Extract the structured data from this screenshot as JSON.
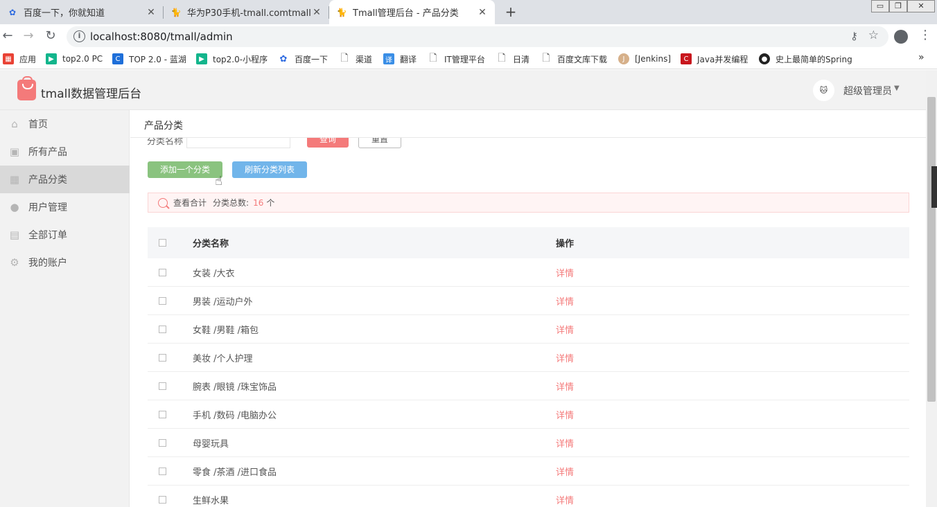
{
  "browser": {
    "tabs": [
      {
        "title": "百度一下，你就知道",
        "active": false
      },
      {
        "title": "华为P30手机-tmall.comtmall",
        "active": false
      },
      {
        "title": "Tmall管理后台 - 产品分类",
        "active": true
      }
    ],
    "new_tab": "+",
    "url": "localhost:8080/tmall/admin",
    "window_controls": [
      "▭",
      "❐",
      "✕"
    ],
    "bookmarks": [
      {
        "label": "应用",
        "icon": "apps-grid-icon",
        "color": "#e94235"
      },
      {
        "label": "top2.0 PC",
        "icon": "play-icon",
        "color": "#13b58c"
      },
      {
        "label": "TOP 2.0 - 蓝湖",
        "icon": "lanhu-icon",
        "color": "#1e6fd9"
      },
      {
        "label": "top2.0-小程序",
        "icon": "play-icon",
        "color": "#13b58c"
      },
      {
        "label": "百度一下",
        "icon": "baidu-paw-icon",
        "color": "#2d6ae0"
      },
      {
        "label": "渠道",
        "icon": "page-icon",
        "color": "#ffffff"
      },
      {
        "label": "翻译",
        "icon": "translate-icon",
        "color": "#3a8ee6"
      },
      {
        "label": "IT管理平台",
        "icon": "page-icon",
        "color": "#ffffff"
      },
      {
        "label": "日清",
        "icon": "page-icon",
        "color": "#ffffff"
      },
      {
        "label": "百度文库下载",
        "icon": "page-icon",
        "color": "#ffffff"
      },
      {
        "label": "[Jenkins]",
        "icon": "jenkins-icon",
        "color": "#d6b08a"
      },
      {
        "label": "Java并发编程",
        "icon": "csdn-icon",
        "color": "#c8161d"
      },
      {
        "label": "史上最简单的Spring",
        "icon": "github-icon",
        "color": "#222222"
      }
    ],
    "bookmarks_more": "»"
  },
  "header": {
    "app_title": "tmall数据管理后台",
    "user_name": "超级管理员",
    "user_caret": "▼"
  },
  "sidebar": {
    "items": [
      {
        "label": "首页",
        "icon": "home-icon",
        "glyph": "⌂",
        "active": false
      },
      {
        "label": "所有产品",
        "icon": "product-icon",
        "glyph": "▣",
        "active": false
      },
      {
        "label": "产品分类",
        "icon": "category-grid-icon",
        "glyph": "▦",
        "active": true
      },
      {
        "label": "用户管理",
        "icon": "user-icon",
        "glyph": "●",
        "active": false
      },
      {
        "label": "全部订单",
        "icon": "order-list-icon",
        "glyph": "▤",
        "active": false
      },
      {
        "label": "我的账户",
        "icon": "gear-icon",
        "glyph": "⚙",
        "active": false
      }
    ]
  },
  "page": {
    "title": "产品分类",
    "search_label": "分类名称",
    "search_placeholder": "",
    "query_button": "查询",
    "reset_button": "重置",
    "add_button": "添加一个分类",
    "refresh_button": "刷新分类列表",
    "summary_label": "查看合计",
    "summary_total_label": "分类总数:",
    "summary_count": "16",
    "summary_unit": "个"
  },
  "table": {
    "headers": {
      "name": "分类名称",
      "action": "操作"
    },
    "rows": [
      {
        "name": "女装 /大衣",
        "action": "详情"
      },
      {
        "name": "男装 /运动户外",
        "action": "详情"
      },
      {
        "name": "女鞋 /男鞋 /箱包",
        "action": "详情"
      },
      {
        "name": "美妆 /个人护理",
        "action": "详情"
      },
      {
        "name": "腕表 /眼镜 /珠宝饰品",
        "action": "详情"
      },
      {
        "name": "手机 /数码 /电脑办公",
        "action": "详情"
      },
      {
        "name": "母婴玩具",
        "action": "详情"
      },
      {
        "name": "零食 /茶酒 /进口食品",
        "action": "详情"
      },
      {
        "name": "生鲜水果",
        "action": "详情"
      }
    ]
  },
  "colors": {
    "accent": "#f47a7a",
    "add_button": "#8ac37f",
    "refresh_button": "#71b5ea",
    "sidebar_bg": "#f2f2f2",
    "sidebar_active": "#d9d9d9"
  }
}
